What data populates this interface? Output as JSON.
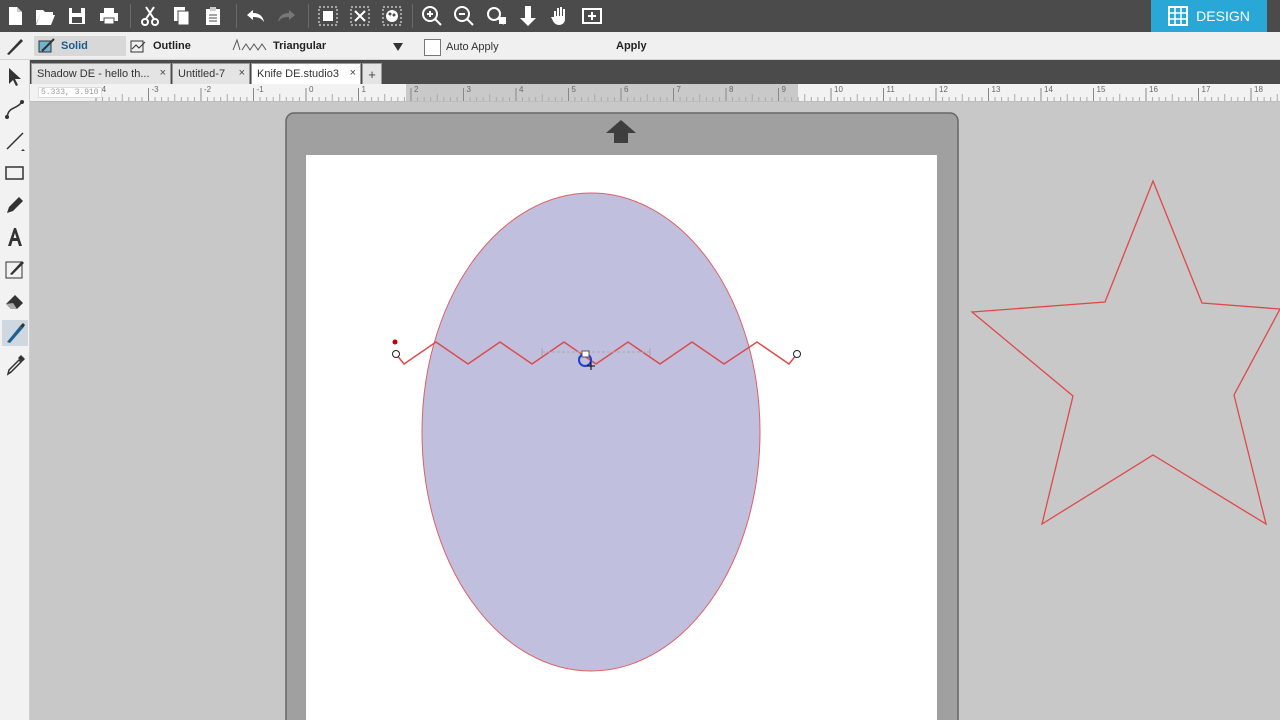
{
  "toolbar": {
    "buttons": [
      "new-icon",
      "open-icon",
      "save-icon",
      "print-icon",
      "cut-icon",
      "copy-icon",
      "paste-icon",
      "undo-icon",
      "redo-icon",
      "select-all-icon",
      "deselect-icon",
      "select-by-color-icon",
      "zoom-in-icon",
      "zoom-out-icon",
      "zoom-fit-icon",
      "move-down-icon",
      "pan-icon",
      "fit-page-icon"
    ]
  },
  "design_button": {
    "label": "DESIGN"
  },
  "options": {
    "solid_label": "Solid",
    "outline_label": "Outline",
    "triangular_label": "Triangular",
    "auto_apply_label": "Auto Apply",
    "apply_label": "Apply"
  },
  "tabs": [
    {
      "label": "Shadow DE - hello th..."
    },
    {
      "label": "Untitled-7"
    },
    {
      "label": "Knife DE.studio3"
    }
  ],
  "tab_close_glyph": "×",
  "tab_add_glyph": "+",
  "ruler": {
    "coordinate": "5.333, 3.910",
    "labels": [
      "-4",
      "-3",
      "-2",
      "-1",
      "0",
      "1",
      "2",
      "3",
      "4",
      "5",
      "6",
      "7",
      "8",
      "9",
      "10",
      "11",
      "12",
      "13",
      "14",
      "15",
      "16",
      "17",
      "18"
    ]
  },
  "left_tools": [
    "select-icon",
    "node-edit-icon",
    "line-icon",
    "rectangle-icon",
    "pencil-icon",
    "text-icon",
    "sketch-icon",
    "eraser-icon",
    "knife-icon",
    "eyedropper-icon"
  ],
  "colors": {
    "shape_fill": "#c0bfde",
    "cut_line": "#dd4a4a",
    "accent": "#29a8d8"
  }
}
